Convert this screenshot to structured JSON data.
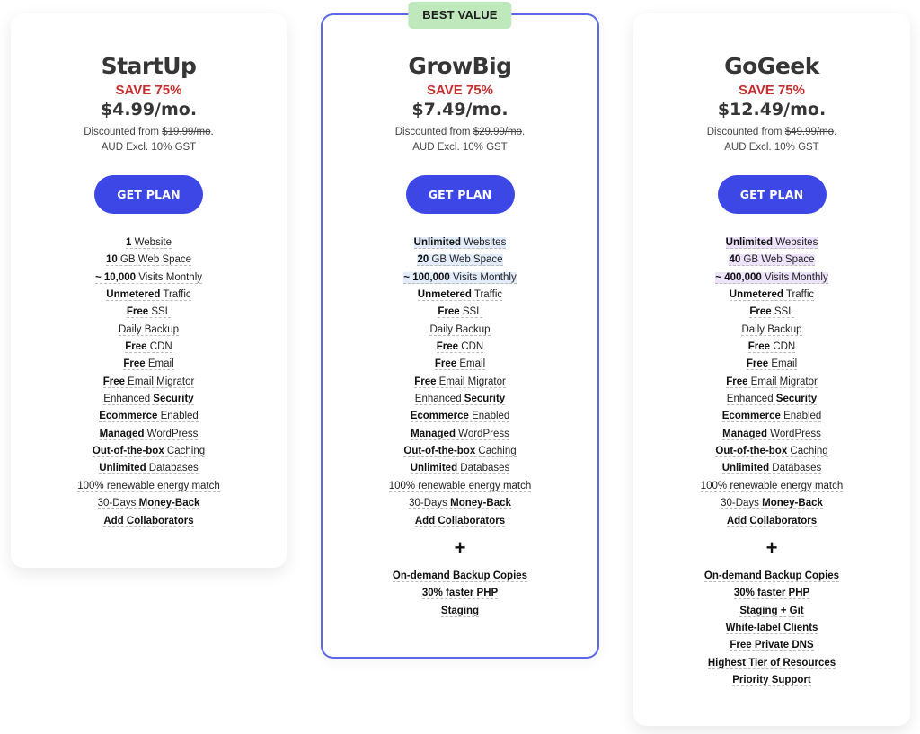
{
  "plans": [
    {
      "name": "StartUp",
      "save": "SAVE 75%",
      "price": "$4.99/mo.",
      "discount_prefix": "Discounted from ",
      "original_price": "$19.99/mo",
      "discount_suffix": ".",
      "gst_note": "AUD Excl. 10% GST",
      "button": "GET PLAN",
      "badge": null,
      "features": [
        {
          "bold": "1",
          "rest": " Website"
        },
        {
          "bold": "10",
          "rest": " GB Web Space"
        },
        {
          "bold": "~ 10,000",
          "rest": " Visits Monthly"
        },
        {
          "bold": "Unmetered",
          "rest": " Traffic"
        },
        {
          "bold": "Free",
          "rest": " SSL"
        },
        {
          "bold": "",
          "rest": "Daily Backup"
        },
        {
          "bold": "Free",
          "rest": " CDN"
        },
        {
          "bold": "Free",
          "rest": " Email"
        },
        {
          "bold": "Free",
          "rest": " Email Migrator"
        },
        {
          "pre": "Enhanced ",
          "bold": "Security",
          "rest": ""
        },
        {
          "bold": "Ecommerce",
          "rest": " Enabled"
        },
        {
          "bold": "Managed",
          "rest": " WordPress"
        },
        {
          "bold": "Out-of-the-box",
          "rest": " Caching"
        },
        {
          "bold": "Unlimited",
          "rest": " Databases"
        },
        {
          "bold": "",
          "rest": "100% renewable energy match"
        },
        {
          "pre": "30-Days ",
          "bold": "Money-Back",
          "rest": ""
        },
        {
          "bold": "Add Collaborators",
          "rest": ""
        }
      ],
      "extras": []
    },
    {
      "name": "GrowBig",
      "save": "SAVE 75%",
      "price": "$7.49/mo.",
      "discount_prefix": "Discounted from ",
      "original_price": "$29.99/mo",
      "discount_suffix": ".",
      "gst_note": "AUD Excl. 10% GST",
      "button": "GET PLAN",
      "badge": "BEST VALUE",
      "features": [
        {
          "bold": "Unlimited",
          "rest": " Websites"
        },
        {
          "bold": "20",
          "rest": " GB Web Space"
        },
        {
          "bold": "~ 100,000",
          "rest": " Visits Monthly"
        },
        {
          "bold": "Unmetered",
          "rest": " Traffic"
        },
        {
          "bold": "Free",
          "rest": " SSL"
        },
        {
          "bold": "",
          "rest": "Daily Backup"
        },
        {
          "bold": "Free",
          "rest": " CDN"
        },
        {
          "bold": "Free",
          "rest": " Email"
        },
        {
          "bold": "Free",
          "rest": " Email Migrator"
        },
        {
          "pre": "Enhanced ",
          "bold": "Security",
          "rest": ""
        },
        {
          "bold": "Ecommerce",
          "rest": " Enabled"
        },
        {
          "bold": "Managed",
          "rest": " WordPress"
        },
        {
          "bold": "Out-of-the-box",
          "rest": " Caching"
        },
        {
          "bold": "Unlimited",
          "rest": " Databases"
        },
        {
          "bold": "",
          "rest": "100% renewable energy match"
        },
        {
          "pre": "30-Days ",
          "bold": "Money-Back",
          "rest": ""
        },
        {
          "bold": "Add Collaborators",
          "rest": ""
        }
      ],
      "highlight": "blue",
      "plus": "+",
      "extras": [
        "On-demand Backup Copies",
        "30% faster PHP",
        "Staging"
      ]
    },
    {
      "name": "GoGeek",
      "save": "SAVE 75%",
      "price": "$12.49/mo.",
      "discount_prefix": "Discounted from ",
      "original_price": "$49.99/mo",
      "discount_suffix": ".",
      "gst_note": "AUD Excl. 10% GST",
      "button": "GET PLAN",
      "badge": null,
      "features": [
        {
          "bold": "Unlimited",
          "rest": " Websites"
        },
        {
          "bold": "40",
          "rest": " GB Web Space"
        },
        {
          "bold": "~ 400,000",
          "rest": " Visits Monthly"
        },
        {
          "bold": "Unmetered",
          "rest": " Traffic"
        },
        {
          "bold": "Free",
          "rest": " SSL"
        },
        {
          "bold": "",
          "rest": "Daily Backup"
        },
        {
          "bold": "Free",
          "rest": " CDN"
        },
        {
          "bold": "Free",
          "rest": " Email"
        },
        {
          "bold": "Free",
          "rest": " Email Migrator"
        },
        {
          "pre": "Enhanced ",
          "bold": "Security",
          "rest": ""
        },
        {
          "bold": "Ecommerce",
          "rest": " Enabled"
        },
        {
          "bold": "Managed",
          "rest": " WordPress"
        },
        {
          "bold": "Out-of-the-box",
          "rest": " Caching"
        },
        {
          "bold": "Unlimited",
          "rest": " Databases"
        },
        {
          "bold": "",
          "rest": "100% renewable energy match"
        },
        {
          "pre": "30-Days ",
          "bold": "Money-Back",
          "rest": ""
        },
        {
          "bold": "Add Collaborators",
          "rest": ""
        }
      ],
      "highlight": "purple",
      "plus": "+",
      "extras": [
        "On-demand Backup Copies",
        "30% faster PHP",
        "Staging + Git",
        "White-label Clients",
        "Free Private DNS",
        "Highest Tier of Resources",
        "Priority Support"
      ]
    }
  ],
  "colors": {
    "button": "#3c47e6",
    "save": "#c92e2e",
    "featured_border": "#5b68e8",
    "badge_bg": "#bfe8bd",
    "highlight_blue": "#e3ecfa",
    "highlight_purple": "#ede3fb"
  }
}
